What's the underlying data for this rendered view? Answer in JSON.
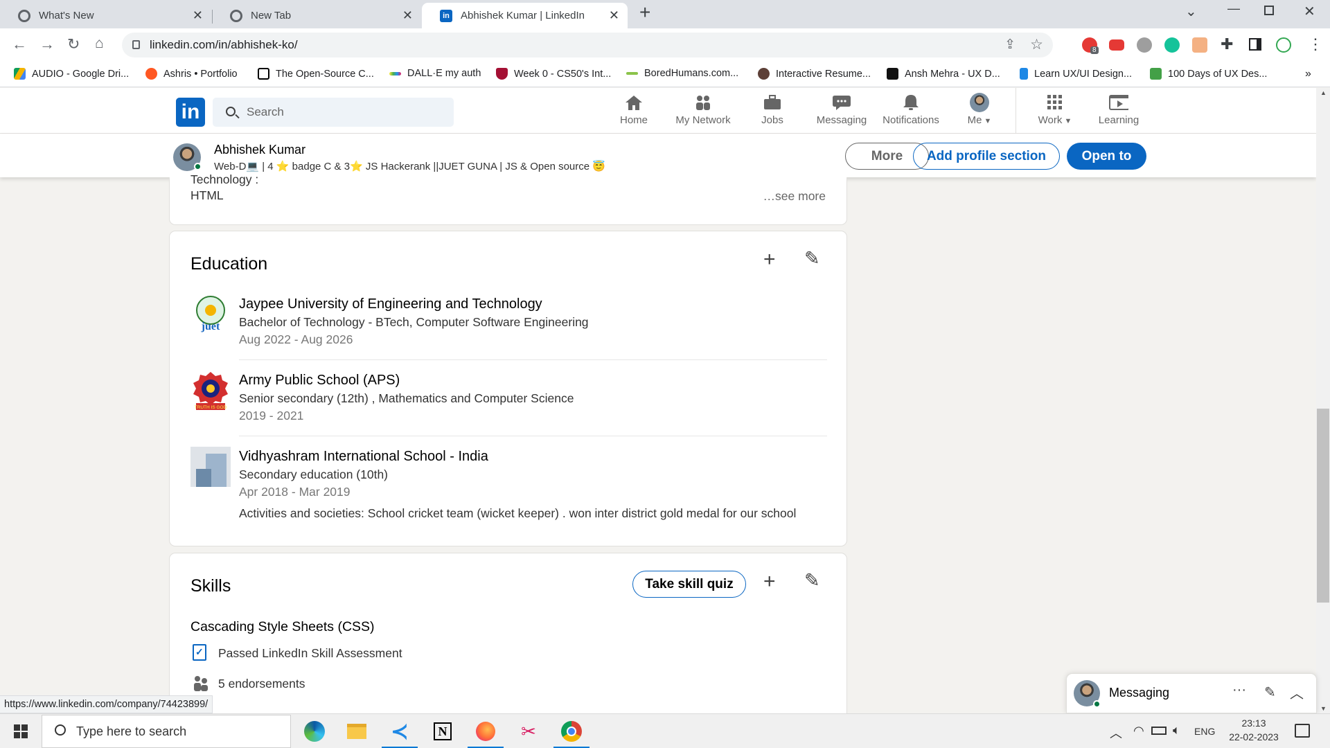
{
  "browser": {
    "tabs": [
      {
        "title": "What's New",
        "active": false
      },
      {
        "title": "New Tab",
        "active": false
      },
      {
        "title": "Abhishek Kumar | LinkedIn",
        "active": true
      }
    ],
    "url": "linkedin.com/in/abhishek-ko/",
    "bookmarks": [
      "AUDIO - Google Dri...",
      "Ashris • Portfolio",
      "The Open-Source C...",
      "DALL·E my auth",
      "Week 0 - CS50's Int...",
      "BoredHumans.com...",
      "Interactive Resume...",
      "Ansh Mehra - UX D...",
      "Learn UX/UI Design...",
      "100 Days of UX Des..."
    ],
    "extension_badge": "8",
    "status_url": "https://www.linkedin.com/company/74423899/"
  },
  "linkedin": {
    "logo": "in",
    "search_placeholder": "Search",
    "nav": [
      {
        "label": "Home",
        "icon": "home-icon"
      },
      {
        "label": "My Network",
        "icon": "network-icon"
      },
      {
        "label": "Jobs",
        "icon": "briefcase-icon"
      },
      {
        "label": "Messaging",
        "icon": "chat-icon"
      },
      {
        "label": "Notifications",
        "icon": "bell-icon"
      },
      {
        "label": "Me",
        "icon": "avatar"
      },
      {
        "label": "Work",
        "icon": "grid-icon"
      },
      {
        "label": "Learning",
        "icon": "play-icon"
      }
    ],
    "profile_bar": {
      "name": "Abhishek Kumar",
      "headline": "Web-D💻 | 4 ⭐ badge C & 3⭐ JS Hackerank ||JUET GUNA | JS & Open source 😇",
      "more": "More",
      "add_section": "Add profile section",
      "open_to": "Open to"
    }
  },
  "about_tail": {
    "line1": "Technology :",
    "line2": "HTML",
    "see_more": "…see more"
  },
  "education": {
    "title": "Education",
    "items": [
      {
        "school": "Jaypee University of Engineering and Technology",
        "degree": "Bachelor of Technology - BTech, Computer Software Engineering",
        "dates": "Aug 2022 - Aug 2026",
        "logo_text": "juet"
      },
      {
        "school": "Army Public School (APS)",
        "degree": "Senior secondary (12th) , Mathematics and Computer Science",
        "dates": "2019 - 2021",
        "logo_text": "TRUTH IS GOD"
      },
      {
        "school": "Vidhyashram International School - India",
        "degree": "Secondary education (10th)",
        "dates": "Apr 2018 - Mar 2019",
        "activities": "Activities and societies: School cricket team (wicket keeper) . won inter district gold medal for our school"
      }
    ]
  },
  "skills": {
    "title": "Skills",
    "quiz_button": "Take skill quiz",
    "items": [
      {
        "name": "Cascading Style Sheets (CSS)",
        "assessment": "Passed LinkedIn Skill Assessment",
        "endorsements": "5 endorsements"
      }
    ]
  },
  "messaging": {
    "title": "Messaging"
  },
  "taskbar": {
    "search_placeholder": "Type here to search",
    "language": "ENG",
    "time": "23:13",
    "date": "22-02-2023"
  },
  "colors": {
    "linkedin_blue": "#0a66c2",
    "page_bg": "#f3f2ef",
    "chrome_tab_bg": "#dee1e6"
  }
}
